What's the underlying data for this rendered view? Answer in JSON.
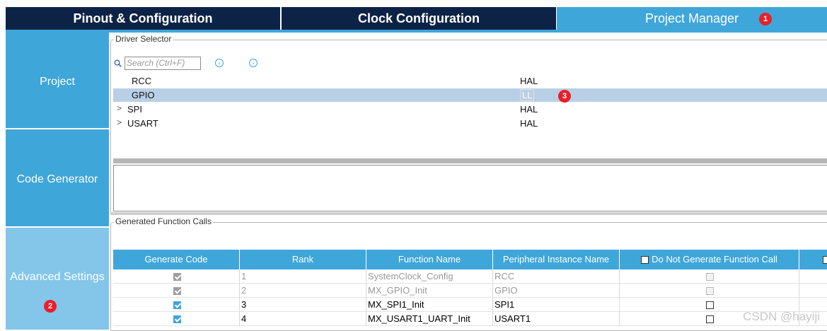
{
  "tabs": [
    {
      "label": "Pinout & Configuration"
    },
    {
      "label": "Clock Configuration"
    },
    {
      "label": "Project Manager",
      "badge": "1"
    }
  ],
  "sidebar": {
    "items": [
      {
        "label": "Project"
      },
      {
        "label": "Code Generator"
      },
      {
        "label": "Advanced Settings",
        "badge": "2"
      }
    ]
  },
  "driver_selector": {
    "title": "Driver Selector",
    "search_placeholder": "Search (Ctrl+F)",
    "rows": [
      {
        "name": "RCC",
        "value": "HAL",
        "expandable": false
      },
      {
        "name": "GPIO",
        "value": "LL",
        "expandable": false,
        "selected": true,
        "badge": "3"
      },
      {
        "name": "SPI",
        "value": "HAL",
        "expandable": true
      },
      {
        "name": "USART",
        "value": "HAL",
        "expandable": true
      }
    ]
  },
  "function_calls": {
    "title": "Generated Function Calls",
    "columns": [
      "Generate Code",
      "Rank",
      "Function Name",
      "Peripheral Instance Name",
      "Do Not Generate Function Call"
    ],
    "rows": [
      {
        "generate": true,
        "rank": "1",
        "function": "SystemClock_Config",
        "instance": "RCC",
        "do_not_generate": false,
        "enabled": false
      },
      {
        "generate": true,
        "rank": "2",
        "function": "MX_GPIO_Init",
        "instance": "GPIO",
        "do_not_generate": false,
        "enabled": false
      },
      {
        "generate": true,
        "rank": "3",
        "function": "MX_SPI1_Init",
        "instance": "SPI1",
        "do_not_generate": false,
        "enabled": true
      },
      {
        "generate": true,
        "rank": "4",
        "function": "MX_USART1_UART_Init",
        "instance": "USART1",
        "do_not_generate": false,
        "enabled": true
      }
    ]
  },
  "watermark": "CSDN @hayiji",
  "colors": {
    "tab_dark": "#0d2346",
    "accent": "#3fa6da",
    "nav_active": "#83c6ea",
    "badge": "#e8202a",
    "selected_row": "#b9cfe6"
  }
}
